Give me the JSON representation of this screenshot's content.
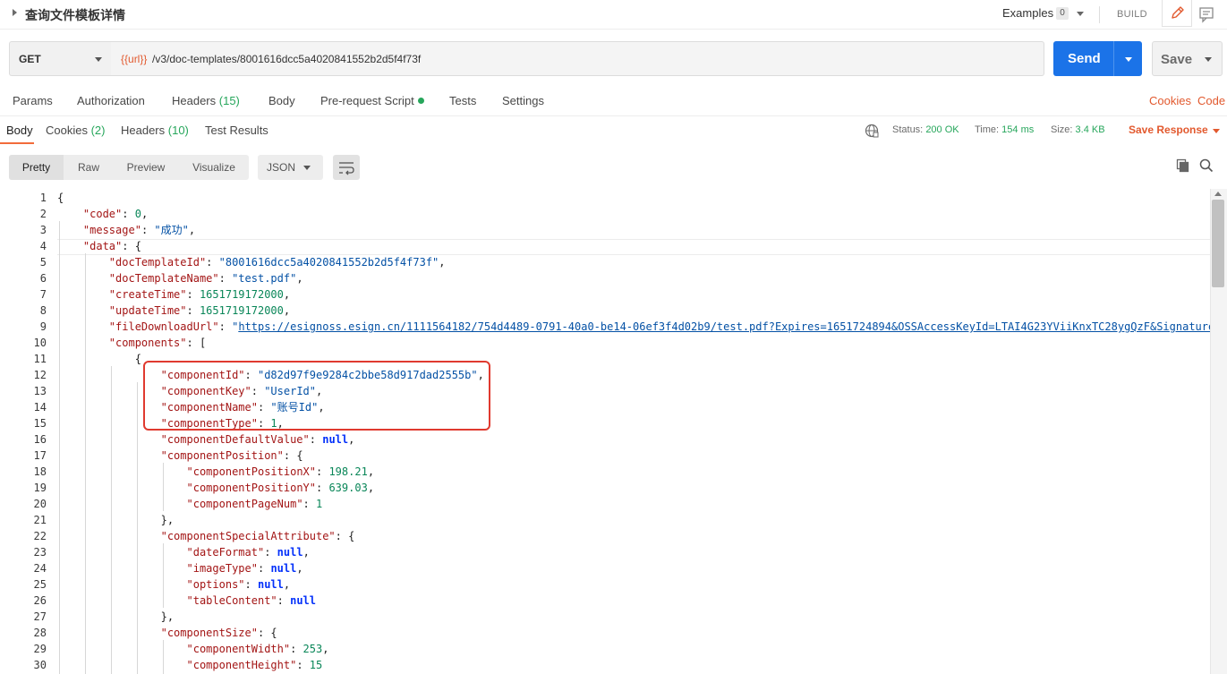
{
  "titlebar": {
    "title": "查询文件模板详情",
    "examples_label": "Examples",
    "examples_count": "0",
    "build_label": "BUILD"
  },
  "request": {
    "method": "GET",
    "url_var": "{{url}}",
    "url_path": "/v3/doc-templates/8001616dcc5a4020841552b2d5f4f73f",
    "send_label": "Send",
    "save_label": "Save"
  },
  "request_tabs": {
    "params": "Params",
    "authorization": "Authorization",
    "headers": "Headers",
    "headers_count": "(15)",
    "body": "Body",
    "prerequest": "Pre-request Script",
    "tests": "Tests",
    "settings": "Settings",
    "cookies": "Cookies",
    "code": "Code"
  },
  "response_tabs": {
    "body": "Body",
    "cookies": "Cookies",
    "cookies_count": "(2)",
    "headers": "Headers",
    "headers_count": "(10)",
    "test_results": "Test Results"
  },
  "response_status": {
    "status_label": "Status:",
    "status_value": "200 OK",
    "time_label": "Time:",
    "time_value": "154 ms",
    "size_label": "Size:",
    "size_value": "3.4 KB",
    "save_response": "Save Response"
  },
  "body_toolbar": {
    "formats": [
      "Pretty",
      "Raw",
      "Preview",
      "Visualize"
    ],
    "active_format": "Pretty",
    "language": "JSON"
  },
  "colors": {
    "accent_orange": "#e2592e",
    "send_blue": "#1b73e8",
    "status_green": "#26a65b",
    "highlight_red": "#e03a2f"
  },
  "code_lines": [
    {
      "n": "1",
      "t": [
        [
          "p",
          "{"
        ]
      ]
    },
    {
      "n": "2",
      "t": [
        [
          "p",
          "    "
        ],
        [
          "k",
          "\"code\""
        ],
        [
          "p",
          ": "
        ],
        [
          "n",
          "0"
        ],
        [
          "p",
          ","
        ]
      ]
    },
    {
      "n": "3",
      "t": [
        [
          "p",
          "    "
        ],
        [
          "k",
          "\"message\""
        ],
        [
          "p",
          ": "
        ],
        [
          "s",
          "\"成功\""
        ],
        [
          "p",
          ","
        ]
      ]
    },
    {
      "n": "4",
      "t": [
        [
          "p",
          "    "
        ],
        [
          "k",
          "\"data\""
        ],
        [
          "p",
          ": {"
        ]
      ]
    },
    {
      "n": "5",
      "t": [
        [
          "p",
          "        "
        ],
        [
          "k",
          "\"docTemplateId\""
        ],
        [
          "p",
          ": "
        ],
        [
          "s",
          "\"8001616dcc5a4020841552b2d5f4f73f\""
        ],
        [
          "p",
          ","
        ]
      ]
    },
    {
      "n": "6",
      "t": [
        [
          "p",
          "        "
        ],
        [
          "k",
          "\"docTemplateName\""
        ],
        [
          "p",
          ": "
        ],
        [
          "s",
          "\"test.pdf\""
        ],
        [
          "p",
          ","
        ]
      ]
    },
    {
      "n": "7",
      "t": [
        [
          "p",
          "        "
        ],
        [
          "k",
          "\"createTime\""
        ],
        [
          "p",
          ": "
        ],
        [
          "n",
          "1651719172000"
        ],
        [
          "p",
          ","
        ]
      ]
    },
    {
      "n": "8",
      "t": [
        [
          "p",
          "        "
        ],
        [
          "k",
          "\"updateTime\""
        ],
        [
          "p",
          ": "
        ],
        [
          "n",
          "1651719172000"
        ],
        [
          "p",
          ","
        ]
      ]
    },
    {
      "n": "9",
      "t": [
        [
          "p",
          "        "
        ],
        [
          "k",
          "\"fileDownloadUrl\""
        ],
        [
          "p",
          ": "
        ],
        [
          "s",
          "\""
        ],
        [
          "u",
          "https://esignoss.esign.cn/1111564182/754d4489-0791-40a0-be14-06ef3f4d02b9/test.pdf?Expires=1651724894&OSSAccessKeyId=LTAI4G23YViiKnxTC28ygQzF&Signature="
        ]
      ]
    },
    {
      "n": "10",
      "t": [
        [
          "p",
          "        "
        ],
        [
          "k",
          "\"components\""
        ],
        [
          "p",
          ": ["
        ]
      ]
    },
    {
      "n": "11",
      "t": [
        [
          "p",
          "            {"
        ]
      ]
    },
    {
      "n": "12",
      "t": [
        [
          "p",
          "                "
        ],
        [
          "k",
          "\"componentId\""
        ],
        [
          "p",
          ": "
        ],
        [
          "s",
          "\"d82d97f9e9284c2bbe58d917dad2555b\""
        ],
        [
          "p",
          ","
        ]
      ]
    },
    {
      "n": "13",
      "t": [
        [
          "p",
          "                "
        ],
        [
          "k",
          "\"componentKey\""
        ],
        [
          "p",
          ": "
        ],
        [
          "s",
          "\"UserId\""
        ],
        [
          "p",
          ","
        ]
      ]
    },
    {
      "n": "14",
      "t": [
        [
          "p",
          "                "
        ],
        [
          "k",
          "\"componentName\""
        ],
        [
          "p",
          ": "
        ],
        [
          "s",
          "\"账号Id\""
        ],
        [
          "p",
          ","
        ]
      ]
    },
    {
      "n": "15",
      "t": [
        [
          "p",
          "                "
        ],
        [
          "k",
          "\"componentType\""
        ],
        [
          "p",
          ": "
        ],
        [
          "n",
          "1"
        ],
        [
          "p",
          ","
        ]
      ]
    },
    {
      "n": "16",
      "t": [
        [
          "p",
          "                "
        ],
        [
          "k",
          "\"componentDefaultValue\""
        ],
        [
          "p",
          ": "
        ],
        [
          "b",
          "null"
        ],
        [
          "p",
          ","
        ]
      ]
    },
    {
      "n": "17",
      "t": [
        [
          "p",
          "                "
        ],
        [
          "k",
          "\"componentPosition\""
        ],
        [
          "p",
          ": {"
        ]
      ]
    },
    {
      "n": "18",
      "t": [
        [
          "p",
          "                    "
        ],
        [
          "k",
          "\"componentPositionX\""
        ],
        [
          "p",
          ": "
        ],
        [
          "n",
          "198.21"
        ],
        [
          "p",
          ","
        ]
      ]
    },
    {
      "n": "19",
      "t": [
        [
          "p",
          "                    "
        ],
        [
          "k",
          "\"componentPositionY\""
        ],
        [
          "p",
          ": "
        ],
        [
          "n",
          "639.03"
        ],
        [
          "p",
          ","
        ]
      ]
    },
    {
      "n": "20",
      "t": [
        [
          "p",
          "                    "
        ],
        [
          "k",
          "\"componentPageNum\""
        ],
        [
          "p",
          ": "
        ],
        [
          "n",
          "1"
        ]
      ]
    },
    {
      "n": "21",
      "t": [
        [
          "p",
          "                },"
        ]
      ]
    },
    {
      "n": "22",
      "t": [
        [
          "p",
          "                "
        ],
        [
          "k",
          "\"componentSpecialAttribute\""
        ],
        [
          "p",
          ": {"
        ]
      ]
    },
    {
      "n": "23",
      "t": [
        [
          "p",
          "                    "
        ],
        [
          "k",
          "\"dateFormat\""
        ],
        [
          "p",
          ": "
        ],
        [
          "b",
          "null"
        ],
        [
          "p",
          ","
        ]
      ]
    },
    {
      "n": "24",
      "t": [
        [
          "p",
          "                    "
        ],
        [
          "k",
          "\"imageType\""
        ],
        [
          "p",
          ": "
        ],
        [
          "b",
          "null"
        ],
        [
          "p",
          ","
        ]
      ]
    },
    {
      "n": "25",
      "t": [
        [
          "p",
          "                    "
        ],
        [
          "k",
          "\"options\""
        ],
        [
          "p",
          ": "
        ],
        [
          "b",
          "null"
        ],
        [
          "p",
          ","
        ]
      ]
    },
    {
      "n": "26",
      "t": [
        [
          "p",
          "                    "
        ],
        [
          "k",
          "\"tableContent\""
        ],
        [
          "p",
          ": "
        ],
        [
          "b",
          "null"
        ]
      ]
    },
    {
      "n": "27",
      "t": [
        [
          "p",
          "                },"
        ]
      ]
    },
    {
      "n": "28",
      "t": [
        [
          "p",
          "                "
        ],
        [
          "k",
          "\"componentSize\""
        ],
        [
          "p",
          ": {"
        ]
      ]
    },
    {
      "n": "29",
      "t": [
        [
          "p",
          "                    "
        ],
        [
          "k",
          "\"componentWidth\""
        ],
        [
          "p",
          ": "
        ],
        [
          "n",
          "253"
        ],
        [
          "p",
          ","
        ]
      ]
    },
    {
      "n": "30",
      "t": [
        [
          "p",
          "                    "
        ],
        [
          "k",
          "\"componentHeight\""
        ],
        [
          "p",
          ": "
        ],
        [
          "n",
          "15"
        ]
      ]
    }
  ]
}
